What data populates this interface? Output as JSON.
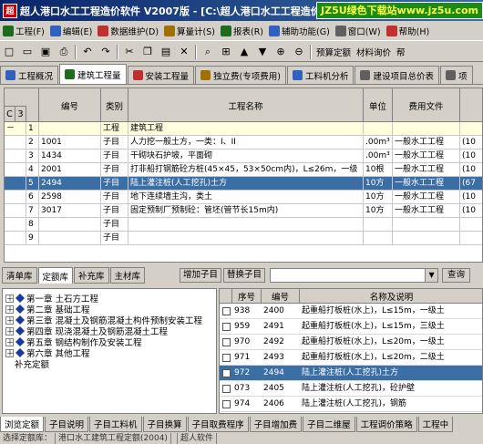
{
  "window": {
    "title": "超人港口水工工程造价软件 V2007版 - [C:\\超人港口水工工程造价...]",
    "watermark": "JZ5U绿色下载站www.jz5u.com"
  },
  "menu": [
    {
      "label": "工程(F)",
      "icon": "book-icon",
      "color": "#1d6b1d"
    },
    {
      "label": "编辑(E)",
      "icon": "edit-icon",
      "color": "#3060c0"
    },
    {
      "label": "数据维护(D)",
      "icon": "database-icon",
      "color": "#c03030"
    },
    {
      "label": "算量计(S)",
      "icon": "calc-icon",
      "color": "#a07000"
    },
    {
      "label": "报表(R)",
      "icon": "report-icon",
      "color": "#1d6b1d"
    },
    {
      "label": "辅助功能(G)",
      "icon": "tool-icon",
      "color": "#3060c0"
    },
    {
      "label": "窗口(W)",
      "icon": "window-icon",
      "color": "#606060"
    },
    {
      "label": "帮助(H)",
      "icon": "help-icon",
      "color": "#c03030"
    }
  ],
  "toolbar": {
    "left_buttons": [
      "new",
      "open",
      "save",
      "print",
      "undo",
      "redo",
      "cut",
      "copy",
      "paste",
      "delete",
      "find",
      "insert",
      "up",
      "down",
      "expand",
      "collapse"
    ],
    "text_buttons": [
      "预算定额",
      "材料询价",
      "帮"
    ]
  },
  "main_tabs": [
    {
      "label": "工程概况",
      "color": "#3060c0"
    },
    {
      "label": "建筑工程量",
      "color": "#1d6b1d",
      "active": true
    },
    {
      "label": "安装工程量",
      "color": "#c03030"
    },
    {
      "label": "独立费(专项费用)",
      "color": "#a07000"
    },
    {
      "label": "工料机分析",
      "color": "#3060c0"
    },
    {
      "label": "建设项目总价表",
      "color": "#606060"
    },
    {
      "label": "项",
      "color": "#606060"
    }
  ],
  "grid": {
    "columns": [
      "编号",
      "类别",
      "工程名称",
      "单位",
      "费用文件"
    ],
    "levels": [
      "C",
      "3"
    ],
    "rows": [
      {
        "no": "1",
        "code": "",
        "type": "工程",
        "name": "建筑工程",
        "unit": "",
        "file": "",
        "extra": "",
        "expand": "－",
        "group": true
      },
      {
        "no": "2",
        "code": "1001",
        "type": "子目",
        "name": "人力挖一般土方，一类：I、II",
        "unit": ".00m³",
        "file": "一般水工工程",
        "extra": "(10"
      },
      {
        "no": "3",
        "code": "1434",
        "type": "子目",
        "name": "干砌块石护坡，平面砌",
        "unit": ".00m³",
        "file": "一般水工工程",
        "extra": "(10"
      },
      {
        "no": "4",
        "code": "2001",
        "type": "子目",
        "name": "打非船打钢筋砼方桩(45×45，53×50cm内)，L≤26m，一级",
        "unit": "10根",
        "file": "一般水工工程",
        "extra": "(10"
      },
      {
        "no": "5",
        "code": "2494",
        "type": "子目",
        "name": "陆上灌注桩(人工挖孔)土方",
        "unit": "10方",
        "file": "一般水工工程",
        "extra": "(67",
        "selected": true
      },
      {
        "no": "6",
        "code": "2598",
        "type": "子目",
        "name": "地下连续墙主沟，类土",
        "unit": "10方",
        "file": "一般水工工程",
        "extra": "(10"
      },
      {
        "no": "7",
        "code": "3017",
        "type": "子目",
        "name": "固定预制厂预制砼：管坯(管节长15m内)",
        "unit": "10方",
        "file": "一般水工工程",
        "extra": "(10"
      },
      {
        "no": "8",
        "code": "",
        "type": "子目",
        "name": "",
        "unit": "",
        "file": "",
        "extra": ""
      },
      {
        "no": "9",
        "code": "",
        "type": "子目",
        "name": "",
        "unit": "",
        "file": "",
        "extra": ""
      }
    ]
  },
  "lower_tabs": [
    {
      "label": "清单库"
    },
    {
      "label": "定额库",
      "active": true
    },
    {
      "label": "补充库"
    },
    {
      "label": "主材库"
    }
  ],
  "sub_controls": {
    "add_label": "增加子目",
    "replace_label": "替换子目",
    "query_label": "查询"
  },
  "tree": [
    {
      "label": "第一章  土石方工程",
      "level": 0,
      "toggle": "＋"
    },
    {
      "label": "第二章  基础工程",
      "level": 0,
      "toggle": "＋"
    },
    {
      "label": "第三章  混凝土及钢筋混凝土构件预制安装工程",
      "level": 0,
      "toggle": "＋"
    },
    {
      "label": "第四章  现浇混凝土及钢筋混凝土工程",
      "level": 0,
      "toggle": "＋"
    },
    {
      "label": "第五章  钢结构制作及安装工程",
      "level": 0,
      "toggle": "＋"
    },
    {
      "label": "第六章  其他工程",
      "level": 0,
      "toggle": "＋"
    },
    {
      "label": "补充定额",
      "level": 1,
      "toggle": ""
    }
  ],
  "catalog": {
    "columns": [
      "序号",
      "编号",
      "名称及说明"
    ],
    "rows": [
      {
        "no": "938",
        "code": "2400",
        "name": "起重船打板桩(水上)，L≤15m，一级土"
      },
      {
        "no": "959",
        "code": "2491",
        "name": "起重船打板桩(水上)，L≤15m，三级土"
      },
      {
        "no": "970",
        "code": "2492",
        "name": "起重船打板桩(水上)，L≤20m，一级土"
      },
      {
        "no": "971",
        "code": "2493",
        "name": "起重船打板桩(水上)，L≤20m，二级土"
      },
      {
        "no": "972",
        "code": "2494",
        "name": "陆上灌注桩(人工挖孔)土方",
        "selected": true
      },
      {
        "no": "073",
        "code": "2405",
        "name": "陆上灌注桩(人工挖孔)，砼护壁"
      },
      {
        "no": "974",
        "code": "2406",
        "name": "陆上灌注桩(人工挖孔)，钢筋"
      }
    ]
  },
  "bottom_tabs": [
    {
      "label": "浏览定额",
      "active": true
    },
    {
      "label": "子目说明"
    },
    {
      "label": "子目工料机"
    },
    {
      "label": "子目换算"
    },
    {
      "label": "子目取费程序"
    },
    {
      "label": "子目增加费"
    },
    {
      "label": "子目二维屋"
    },
    {
      "label": "工程调价策略"
    },
    {
      "label": "工程中"
    }
  ],
  "status": [
    "选择定额库：",
    "港口水工建筑工程定额(2004)",
    "",
    "超人软件"
  ]
}
